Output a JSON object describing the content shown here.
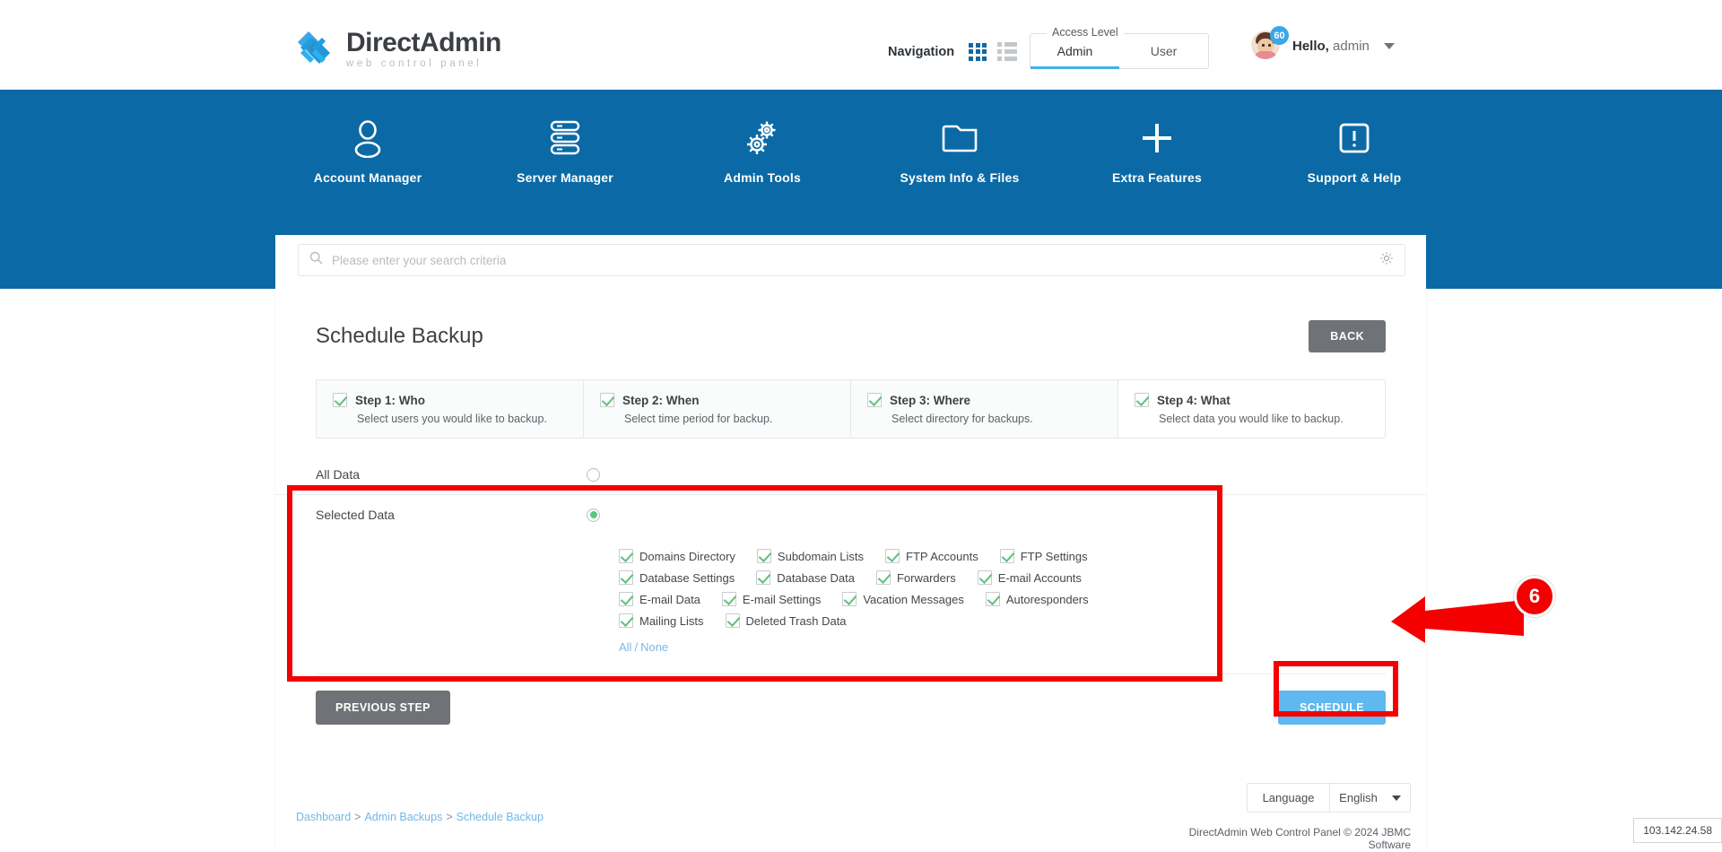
{
  "brand": {
    "title_part1": "Direct",
    "title_part2": "Admin",
    "subtitle": "web control panel",
    "logo_icon": "chevron-double-right-logo"
  },
  "header": {
    "navigation_label": "Navigation",
    "grid_view_icon": "grid-view-icon",
    "list_view_icon": "list-view-icon",
    "access_level_legend": "Access Level",
    "access_tabs": [
      {
        "label": "Admin",
        "active": true
      },
      {
        "label": "User",
        "active": false
      }
    ],
    "user": {
      "greeting": "Hello,",
      "name": "admin",
      "badge_count": "60",
      "avatar_icon": "user-avatar",
      "dropdown_icon": "chevron-down-icon"
    }
  },
  "mainnav": {
    "items": [
      {
        "label": "Account Manager",
        "icon": "user-icon"
      },
      {
        "label": "Server Manager",
        "icon": "server-stack-icon"
      },
      {
        "label": "Admin Tools",
        "icon": "gears-icon"
      },
      {
        "label": "System Info & Files",
        "icon": "folder-icon"
      },
      {
        "label": "Extra Features",
        "icon": "plus-icon"
      },
      {
        "label": "Support & Help",
        "icon": "exclamation-circle-icon"
      }
    ]
  },
  "search": {
    "placeholder": "Please enter your search criteria",
    "value": "",
    "search_icon": "search-icon",
    "settings_icon": "gear-icon"
  },
  "main": {
    "page_title": "Schedule Backup",
    "back_button": "BACK",
    "steps": [
      {
        "title": "Step 1: Who",
        "desc": "Select users you would like to backup.",
        "checked": true,
        "active": false
      },
      {
        "title": "Step 2: When",
        "desc": "Select time period for backup.",
        "checked": true,
        "active": false
      },
      {
        "title": "Step 3: Where",
        "desc": "Select directory for backups.",
        "checked": true,
        "active": false
      },
      {
        "title": "Step 4: What",
        "desc": "Select data you would like to backup.",
        "checked": true,
        "active": true
      }
    ],
    "options": {
      "all_data_label": "All Data",
      "all_data_selected": false,
      "selected_data_label": "Selected Data",
      "selected_data_selected": true
    },
    "data_checkboxes": [
      [
        {
          "label": "Domains Directory",
          "checked": true
        },
        {
          "label": "Subdomain Lists",
          "checked": true
        },
        {
          "label": "FTP Accounts",
          "checked": true
        },
        {
          "label": "FTP Settings",
          "checked": true
        }
      ],
      [
        {
          "label": "Database Settings",
          "checked": true
        },
        {
          "label": "Database Data",
          "checked": true
        },
        {
          "label": "Forwarders",
          "checked": true
        },
        {
          "label": "E-mail Accounts",
          "checked": true
        }
      ],
      [
        {
          "label": "E-mail Data",
          "checked": true
        },
        {
          "label": "E-mail Settings",
          "checked": true
        },
        {
          "label": "Vacation Messages",
          "checked": true
        },
        {
          "label": "Autoresponders",
          "checked": true
        }
      ],
      [
        {
          "label": "Mailing Lists",
          "checked": true
        },
        {
          "label": "Deleted Trash Data",
          "checked": true
        }
      ]
    ],
    "select_all_label": "All",
    "select_separator": "/",
    "select_none_label": "None",
    "previous_step_button": "PREVIOUS STEP",
    "schedule_button": "SCHEDULE"
  },
  "footer": {
    "language_label": "Language",
    "language_value": "English",
    "language_caret_icon": "caret-down-icon",
    "breadcrumb": [
      {
        "label": "Dashboard"
      },
      {
        "label": "Admin Backups"
      },
      {
        "label": "Schedule Backup"
      }
    ],
    "breadcrumb_separator": ">",
    "copyright": "DirectAdmin Web Control Panel © 2024 JBMC Software"
  },
  "annotations": {
    "step_number": "6",
    "arrow_icon": "arrow-pointing-left-icon"
  },
  "overlay": {
    "ip_address": "103.142.24.58"
  },
  "colors": {
    "brand_blue": "#0b6aa5",
    "accent_blue": "#44b0ef",
    "schedule_blue": "#5fb8ef",
    "check_green": "#60c07c",
    "annotation_red": "#f40000",
    "gray_button": "#6f7276"
  }
}
